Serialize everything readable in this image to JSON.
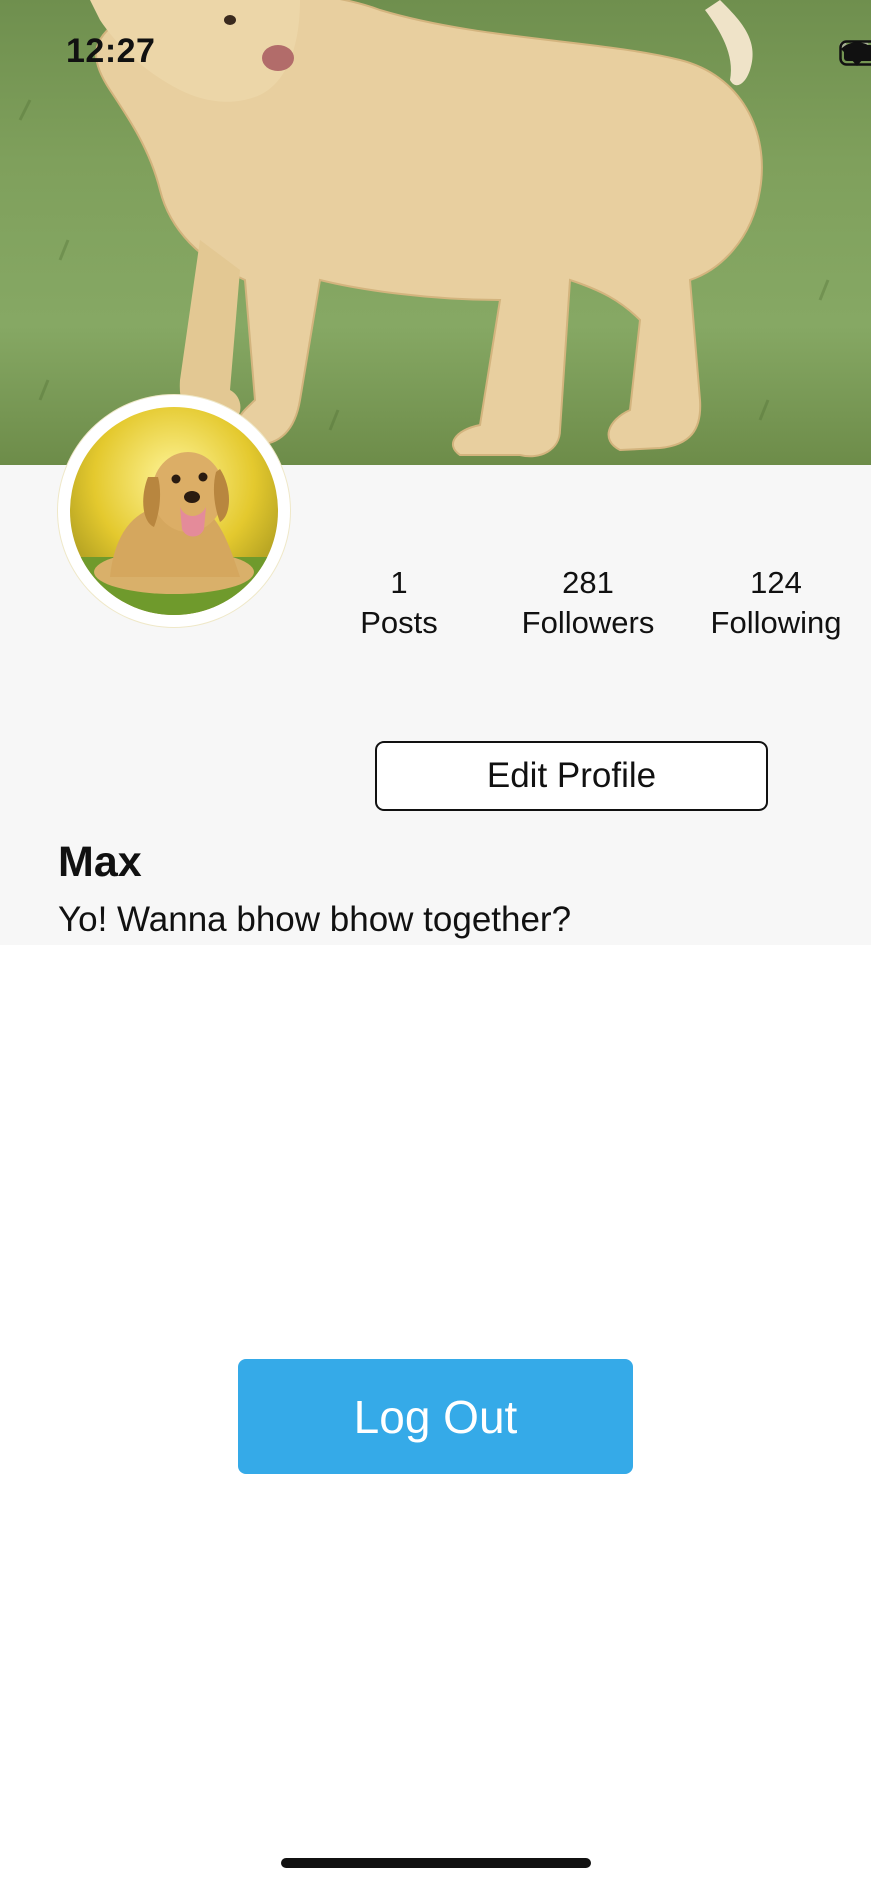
{
  "status_bar": {
    "time": "12:27",
    "icons": [
      "cellular-signal-icon",
      "wifi-icon",
      "battery-icon"
    ]
  },
  "cover": {
    "image": "cover-photo-labrador-on-grass"
  },
  "profile": {
    "avatar": "avatar-photo-labrador-puppy",
    "stats": [
      {
        "value": "1",
        "label": "Posts"
      },
      {
        "value": "281",
        "label": "Followers"
      },
      {
        "value": "124",
        "label": "Following"
      }
    ],
    "edit_button": "Edit Profile",
    "name": "Max",
    "bio": "Yo! Wanna bhow bhow together?"
  },
  "logout_button": "Log Out",
  "colors": {
    "accent": "#35aae8",
    "panel_bg": "#f7f7f7",
    "text": "#111111"
  }
}
